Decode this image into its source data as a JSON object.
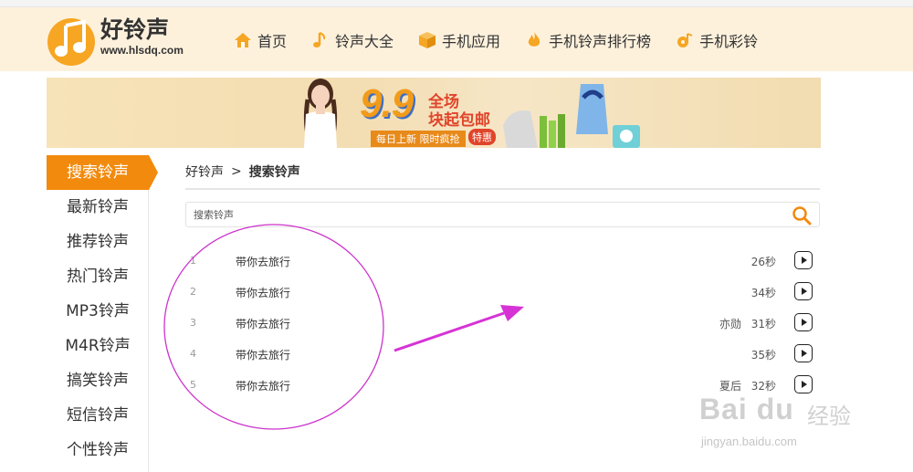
{
  "site": {
    "name": "好铃声",
    "url": "www.hlsdq.com"
  },
  "nav": {
    "items": [
      {
        "label": "首页",
        "icon": "home-icon"
      },
      {
        "label": "铃声大全",
        "icon": "music-note-icon"
      },
      {
        "label": "手机应用",
        "icon": "box-icon"
      },
      {
        "label": "手机铃声排行榜",
        "icon": "flame-icon"
      },
      {
        "label": "手机彩铃",
        "icon": "music-disc-icon"
      }
    ]
  },
  "banner": {
    "big_text": "9.9",
    "line1": "全场",
    "line2": "块起包邮",
    "sub_text": "每日上新 限时疯抢",
    "tag": "特惠"
  },
  "sidebar": {
    "items": [
      {
        "label": "搜索铃声",
        "active": true
      },
      {
        "label": "最新铃声"
      },
      {
        "label": "推荐铃声"
      },
      {
        "label": "热门铃声"
      },
      {
        "label": "MP3铃声"
      },
      {
        "label": "M4R铃声"
      },
      {
        "label": "搞笑铃声"
      },
      {
        "label": "短信铃声"
      },
      {
        "label": "个性铃声"
      }
    ]
  },
  "breadcrumb": {
    "home": "好铃声",
    "separator": ">",
    "current": "搜索铃声"
  },
  "search": {
    "placeholder": "搜索铃声",
    "value": ""
  },
  "results": [
    {
      "num": "1",
      "title": "带你去旅行",
      "singer": "",
      "duration": "26秒"
    },
    {
      "num": "2",
      "title": "带你去旅行",
      "singer": "",
      "duration": "34秒"
    },
    {
      "num": "3",
      "title": "带你去旅行",
      "singer": "亦勋",
      "duration": "31秒"
    },
    {
      "num": "4",
      "title": "带你去旅行",
      "singer": "",
      "duration": "35秒"
    },
    {
      "num": "5",
      "title": "带你去旅行",
      "singer": "夏后",
      "duration": "32秒"
    }
  ],
  "watermark": {
    "brand": "Bai du",
    "cn": "经验",
    "url": "jingyan.baidu.com"
  },
  "colors": {
    "accent": "#f28a0d",
    "header_bg": "#fdf1dc",
    "annotation": "#cc33cc"
  }
}
